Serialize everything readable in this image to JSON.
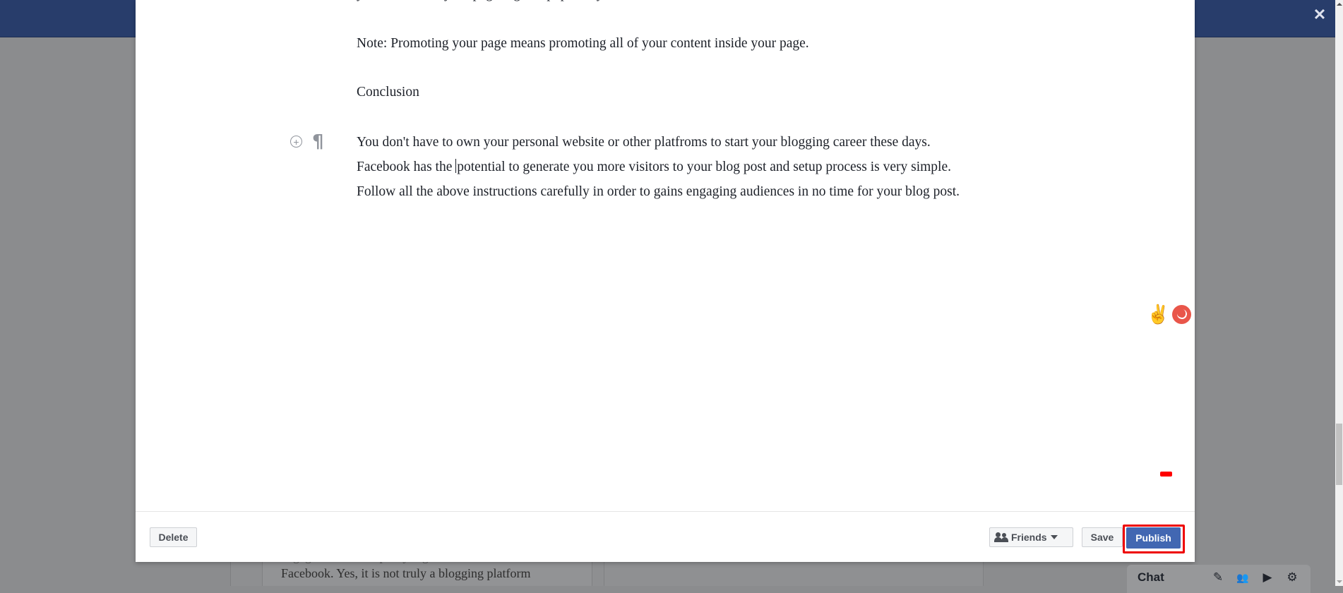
{
  "header": {
    "close_label": "✕"
  },
  "background_page": {
    "line1": "engagement rate is pretty higher in the case of",
    "line2": "Facebook. Yes, it is not truly a blogging platform"
  },
  "editor": {
    "cut_line": "           you must boost your page organic popularity.",
    "note": "Note: Promoting your page means promoting all of your content inside your page.",
    "heading": "Conclusion",
    "paragraph_before_caret": "You don't have to own your personal website or other platfroms to start your blogging career these days. Facebook has the ",
    "paragraph_after_caret": "potential to generate you more visitors to your blog post and setup process is very simple. Follow all the above instructions carefully in order to gains engaging audiences in no time for your blog post.",
    "add_block_icon": "+",
    "pilcrow_icon": "¶",
    "peace_emoji": "✌"
  },
  "footer": {
    "delete_label": "Delete",
    "privacy_label": "Friends",
    "save_label": "Save",
    "publish_label": "Publish"
  },
  "chat": {
    "label": "Chat",
    "icons": {
      "compose": "✎",
      "people": "👥",
      "video": "▶",
      "settings": "⚙"
    }
  },
  "colors": {
    "header_blue": "#283d6b",
    "publish_blue": "#4267b2",
    "highlight_red": "#ee0000"
  }
}
